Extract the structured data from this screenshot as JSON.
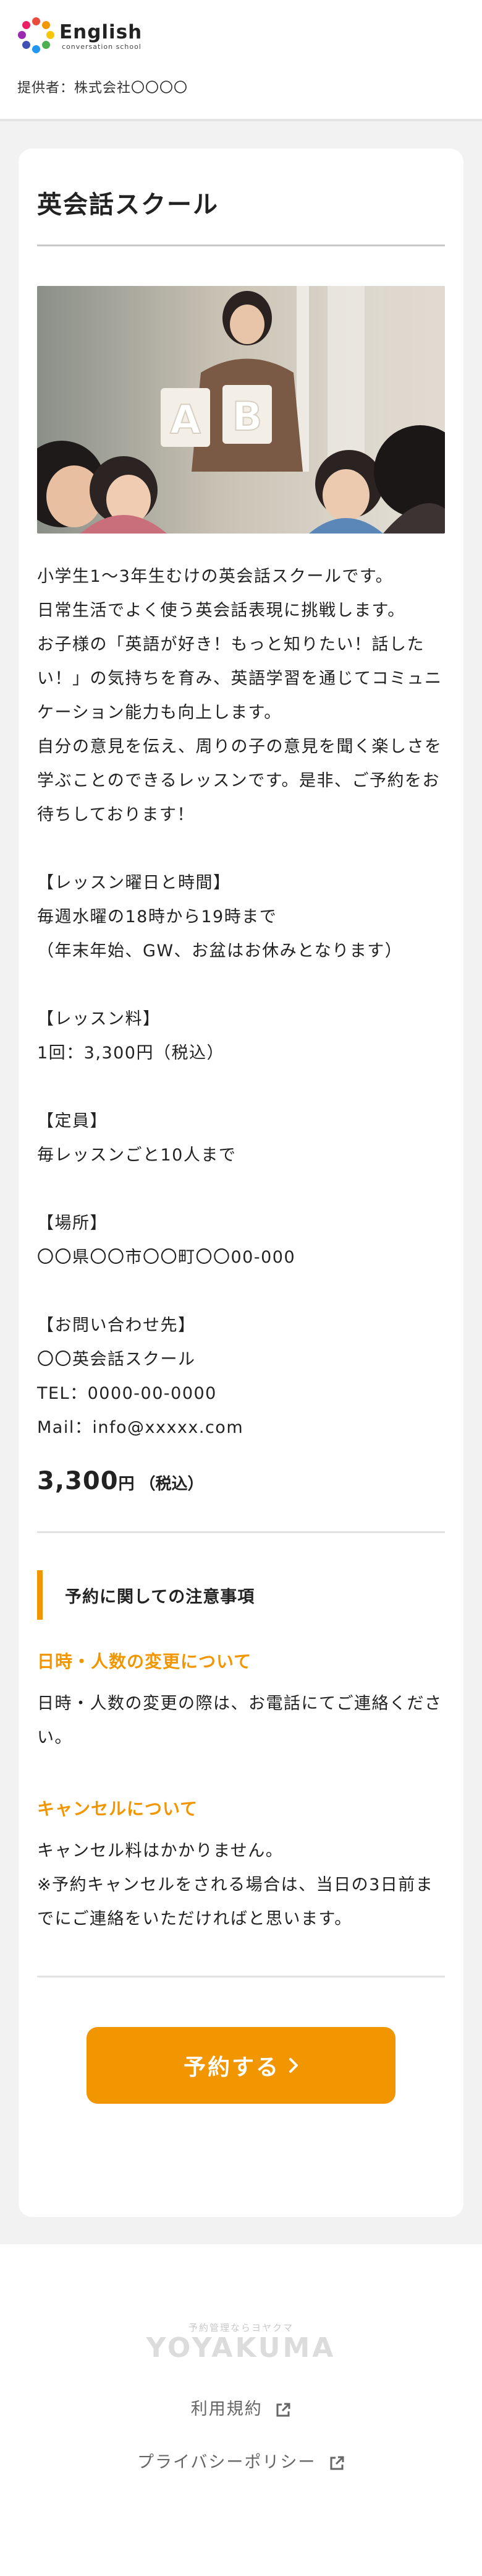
{
  "header": {
    "logo_title": "English",
    "logo_sub": "conversation school",
    "provider": "提供者：株式会社〇〇〇〇"
  },
  "card": {
    "title": "英会話スクール",
    "description": "小学生1〜3年生むけの英会話スクールです。\n日常生活でよく使う英会話表現に挑戦します。\nお子様の「英語が好き！もっと知りたい！話したい！」の気持ちを育み、英語学習を通じてコミュニケーション能力も向上します。\n自分の意見を伝え、周りの子の意見を聞く楽しさを学ぶことのできるレッスンです。是非、ご予約をお待ちしております！\n\n【レッスン曜日と時間】\n毎週水曜の18時から19時まで\n（年末年始、GW、お盆はお休みとなります）\n\n【レッスン料】\n1回：3,300円（税込）\n\n【定員】\n毎レッスンごと10人まで\n\n【場所】\n〇〇県〇〇市〇〇町〇〇00-000\n\n【お問い合わせ先】\n〇〇英会話スクール\nTEL：0000-00-0000\nMail：info@xxxxx.com",
    "price_amount": "3,300",
    "price_unit": "円",
    "price_tax": "（税込）",
    "notice_title": "予約に関しての注意事項",
    "change_head": "日時・人数の変更について",
    "change_body": "日時・人数の変更の際は、お電話にてご連絡ください。",
    "cancel_head": "キャンセルについて",
    "cancel_body": "キャンセル料はかかりません。\n※予約キャンセルをされる場合は、当日の3日前までにご連絡をいただければと思います。",
    "reserve_label": "予約する",
    "reserve_chevron": "›"
  },
  "footer": {
    "brand_small": "予約管理ならヨヤクマ",
    "brand": "YOYAKUMA",
    "terms_label": "利用規約",
    "privacy_label": "プライバシーポリシー"
  },
  "colors": {
    "accent": "#f29600",
    "page_bg": "#f2f2f2"
  },
  "icons": {
    "external_link": "external-link-icon",
    "chevron": "chevron-right-icon"
  }
}
